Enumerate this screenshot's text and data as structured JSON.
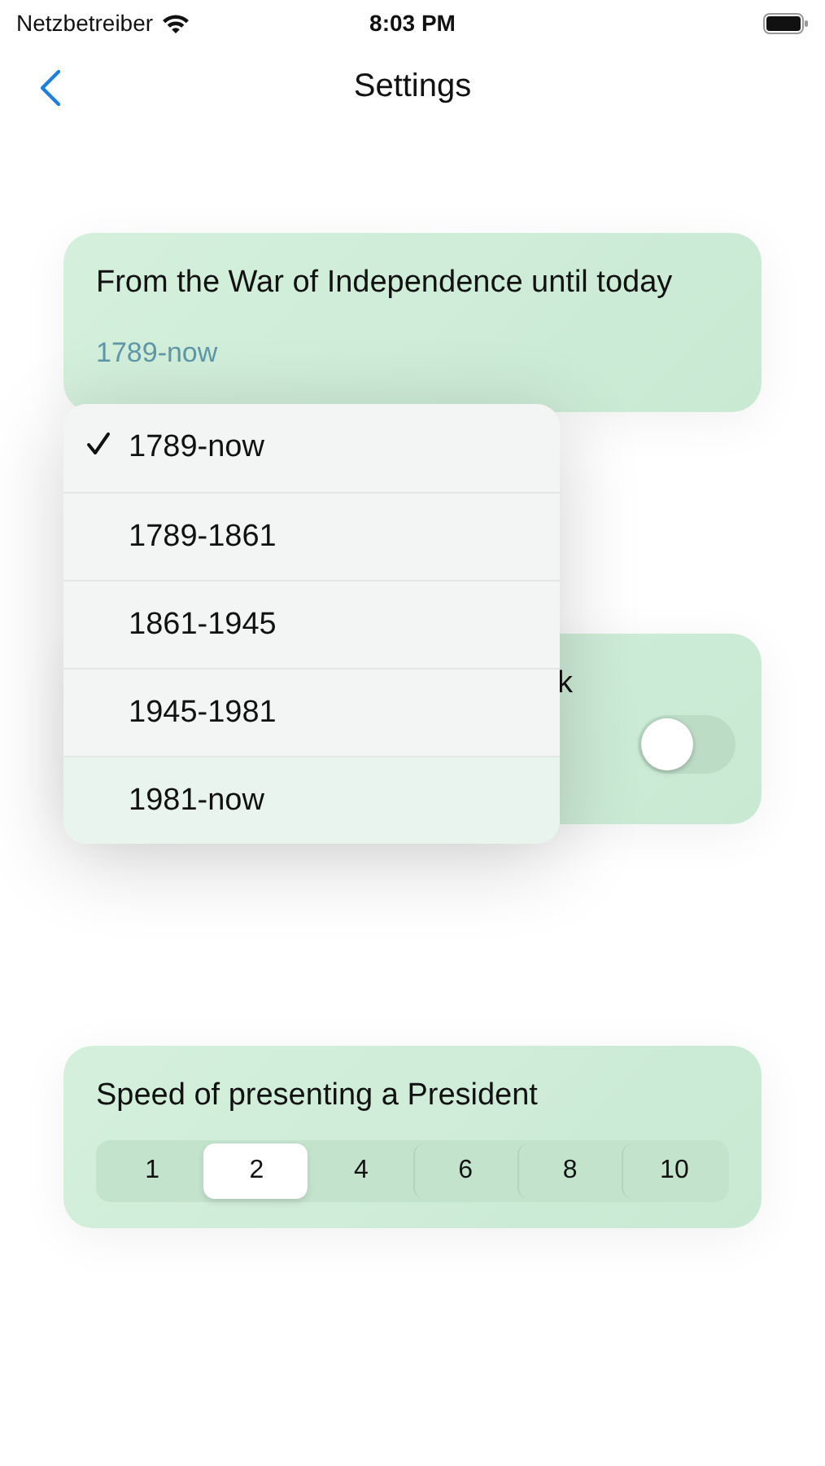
{
  "status_bar": {
    "carrier": "Netzbetreiber",
    "time": "8:03 PM"
  },
  "nav": {
    "title": "Settings"
  },
  "period_card": {
    "title": "From the War of Independence until today",
    "value": "1789-now"
  },
  "period_menu": [
    {
      "label": "1789-now",
      "selected": true
    },
    {
      "label": "1789-1861",
      "selected": false
    },
    {
      "label": "1861-1945",
      "selected": false
    },
    {
      "label": "1945-1981",
      "selected": false
    },
    {
      "label": "1981-now",
      "selected": false
    }
  ],
  "toggle_card": {
    "title": "k",
    "on": false
  },
  "speed_card": {
    "title": "Speed of presenting a President",
    "options": [
      {
        "label": "1",
        "selected": false
      },
      {
        "label": "2",
        "selected": true
      },
      {
        "label": "4",
        "selected": false
      },
      {
        "label": "6",
        "selected": false
      },
      {
        "label": "8",
        "selected": false
      },
      {
        "label": "10",
        "selected": false
      }
    ]
  }
}
